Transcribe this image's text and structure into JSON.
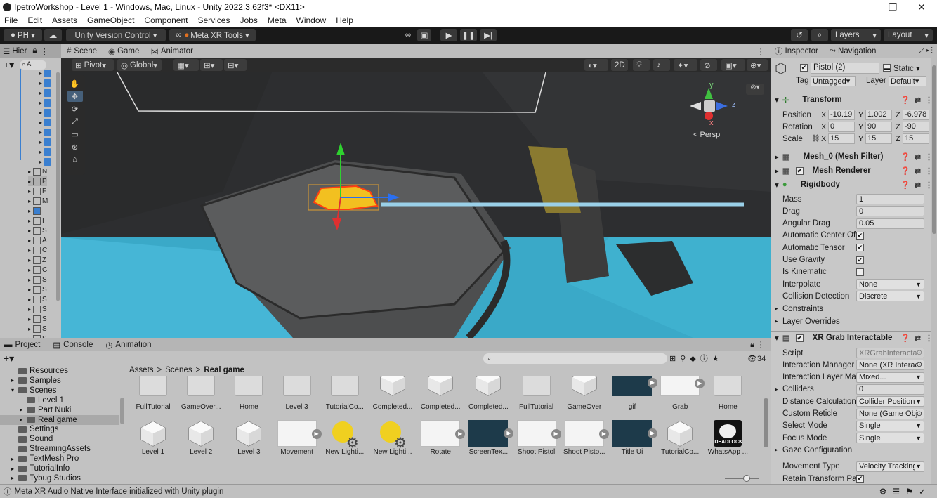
{
  "window": {
    "title": "IpetroWorkshop - Level 1 - Windows, Mac, Linux - Unity 2022.3.62f3* <DX11>",
    "minimize": "—",
    "maximize": "❐",
    "close": "✕"
  },
  "menu": [
    "File",
    "Edit",
    "Assets",
    "GameObject",
    "Component",
    "Services",
    "Jobs",
    "Meta",
    "Window",
    "Help"
  ],
  "toolbar": {
    "account": "PH ▾",
    "version_control": "Unity Version Control ▾",
    "meta_tools": "Meta XR Tools ▾",
    "layers": "Layers",
    "layout": "Layout"
  },
  "hierarchy": {
    "tab": "Hier",
    "search": "A",
    "letters": [
      "N",
      "P",
      "F",
      "M",
      "",
      "I",
      "S",
      "A",
      "C",
      "Z",
      "C",
      "S",
      "S",
      "S",
      "S",
      "S",
      "S",
      "S"
    ]
  },
  "scene": {
    "tabs": [
      "Scene",
      "Game",
      "Animator"
    ],
    "pivot": "Pivot",
    "global": "Global",
    "mode2d": "2D",
    "persp": "< Persp",
    "gizmo": {
      "y": "y",
      "z": "z",
      "x": "x"
    }
  },
  "inspector": {
    "tabs": [
      "Inspector",
      "Navigation"
    ],
    "object_name": "Pistol (2)",
    "static": "Static",
    "tag_label": "Tag",
    "tag": "Untagged",
    "layer_label": "Layer",
    "layer": "Default",
    "transform": {
      "title": "Transform",
      "position_label": "Position",
      "position": {
        "x": "-10.19",
        "y": "1.002",
        "z": "-6.978"
      },
      "rotation_label": "Rotation",
      "rotation": {
        "x": "0",
        "y": "90",
        "z": "-90"
      },
      "scale_label": "Scale",
      "scale": {
        "x": "15",
        "y": "15",
        "z": "15"
      }
    },
    "mesh_filter": "Mesh_0 (Mesh Filter)",
    "mesh_renderer": "Mesh Renderer",
    "rigidbody": {
      "title": "Rigidbody",
      "rows": [
        {
          "label": "Mass",
          "value": "1"
        },
        {
          "label": "Drag",
          "value": "0"
        },
        {
          "label": "Angular Drag",
          "value": "0.05"
        },
        {
          "label": "Automatic Center Of",
          "check": "✔"
        },
        {
          "label": "Automatic Tensor",
          "check": "✔"
        },
        {
          "label": "Use Gravity",
          "check": "✔"
        },
        {
          "label": "Is Kinematic",
          "check": ""
        },
        {
          "label": "Interpolate",
          "value": "None"
        },
        {
          "label": "Collision Detection",
          "value": "Discrete"
        }
      ],
      "constraints": "Constraints",
      "layer_overrides": "Layer Overrides"
    },
    "xr_grab": {
      "title": "XR Grab Interactable",
      "rows": [
        {
          "label": "Script",
          "value": "XRGrabInteractable"
        },
        {
          "label": "Interaction Manager",
          "value": "None (XR Interac"
        },
        {
          "label": "Interaction Layer Ma",
          "value": "Mixed..."
        },
        {
          "label": "Colliders",
          "value": "0"
        },
        {
          "label": "Distance Calculation",
          "value": "Collider Position"
        },
        {
          "label": "Custom Reticle",
          "value": "None (Game Obj"
        },
        {
          "label": "Select Mode",
          "value": "Single"
        },
        {
          "label": "Focus Mode",
          "value": "Single"
        },
        {
          "label": "Gaze Configuration",
          "value": ""
        },
        {
          "label": "Movement Type",
          "value": "Velocity Tracking"
        },
        {
          "label": "Retain Transform Pa",
          "check": "✔"
        }
      ]
    }
  },
  "project": {
    "tabs": [
      "Project",
      "Console",
      "Animation"
    ],
    "count": "34",
    "breadcrumb": [
      "Assets",
      "Scenes",
      "Real game"
    ],
    "tree": [
      {
        "name": "Resources",
        "indent": 0
      },
      {
        "name": "Samples",
        "indent": 0
      },
      {
        "name": "Scenes",
        "indent": 0
      },
      {
        "name": "Level 1",
        "indent": 1
      },
      {
        "name": "Part Nuki",
        "indent": 1
      },
      {
        "name": "Real game",
        "indent": 1
      },
      {
        "name": "Settings",
        "indent": 0
      },
      {
        "name": "Sound",
        "indent": 0
      },
      {
        "name": "StreamingAssets",
        "indent": 0
      },
      {
        "name": "TextMesh Pro",
        "indent": 0
      },
      {
        "name": "TutorialInfo",
        "indent": 0
      },
      {
        "name": "Tybug Studios",
        "indent": 0
      }
    ],
    "row1": [
      "FullTutorial",
      "GameOver...",
      "Home",
      "Level 3",
      "TutorialCo...",
      "Completed...",
      "Completed...",
      "Completed...",
      "FullTutorial",
      "GameOver",
      "gif",
      "Grab",
      "Home"
    ],
    "row2": [
      "Level 1",
      "Level 2",
      "Level 3",
      "Movement",
      "New Lighti...",
      "New Lighti...",
      "Rotate",
      "ScreenTex...",
      "Shoot Pistol",
      "Shoot Pisto...",
      "Title Ui",
      "TutorialCo...",
      "WhatsApp ..."
    ]
  },
  "status": "Meta XR Audio Native Interface initialized with Unity plugin"
}
